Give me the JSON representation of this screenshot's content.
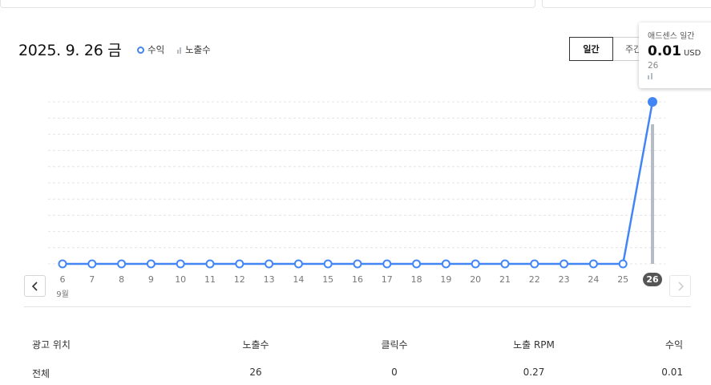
{
  "header": {
    "date_title": "2025. 9. 26 금",
    "legend": {
      "revenue_label": "수익",
      "impressions_label": "노출수"
    }
  },
  "period_toggle": {
    "daily_label": "일간",
    "weekly_label": "주간"
  },
  "tooltip": {
    "title": "애드센스 일간",
    "value": "0.01",
    "unit": "USD",
    "impressions": "26"
  },
  "chart_data": {
    "type": "line",
    "x": [
      "6",
      "7",
      "8",
      "9",
      "10",
      "11",
      "12",
      "13",
      "14",
      "15",
      "16",
      "17",
      "18",
      "19",
      "20",
      "21",
      "22",
      "23",
      "24",
      "25",
      "26"
    ],
    "month_label": "9월",
    "selected_x": "26",
    "series": [
      {
        "name": "수익",
        "type": "line",
        "values": [
          0,
          0,
          0,
          0,
          0,
          0,
          0,
          0,
          0,
          0,
          0,
          0,
          0,
          0,
          0,
          0,
          0,
          0,
          0,
          0,
          0.01
        ]
      },
      {
        "name": "노출수",
        "type": "bar",
        "values": [
          0,
          0,
          0,
          0,
          0,
          0,
          0,
          0,
          0,
          0,
          0,
          0,
          0,
          0,
          0,
          0,
          0,
          0,
          0,
          0,
          26
        ]
      }
    ],
    "grid": true,
    "colors": {
      "revenue": "#4285f4",
      "impressions": "#b5bcc6",
      "grid": "#e4e4e4",
      "selected_badge": "#555555"
    }
  },
  "table": {
    "headers": [
      "광고 위치",
      "노출수",
      "클릭수",
      "노출 RPM",
      "수익"
    ],
    "rows": [
      [
        "전체",
        "26",
        "0",
        "0.27",
        "0.01"
      ]
    ]
  }
}
